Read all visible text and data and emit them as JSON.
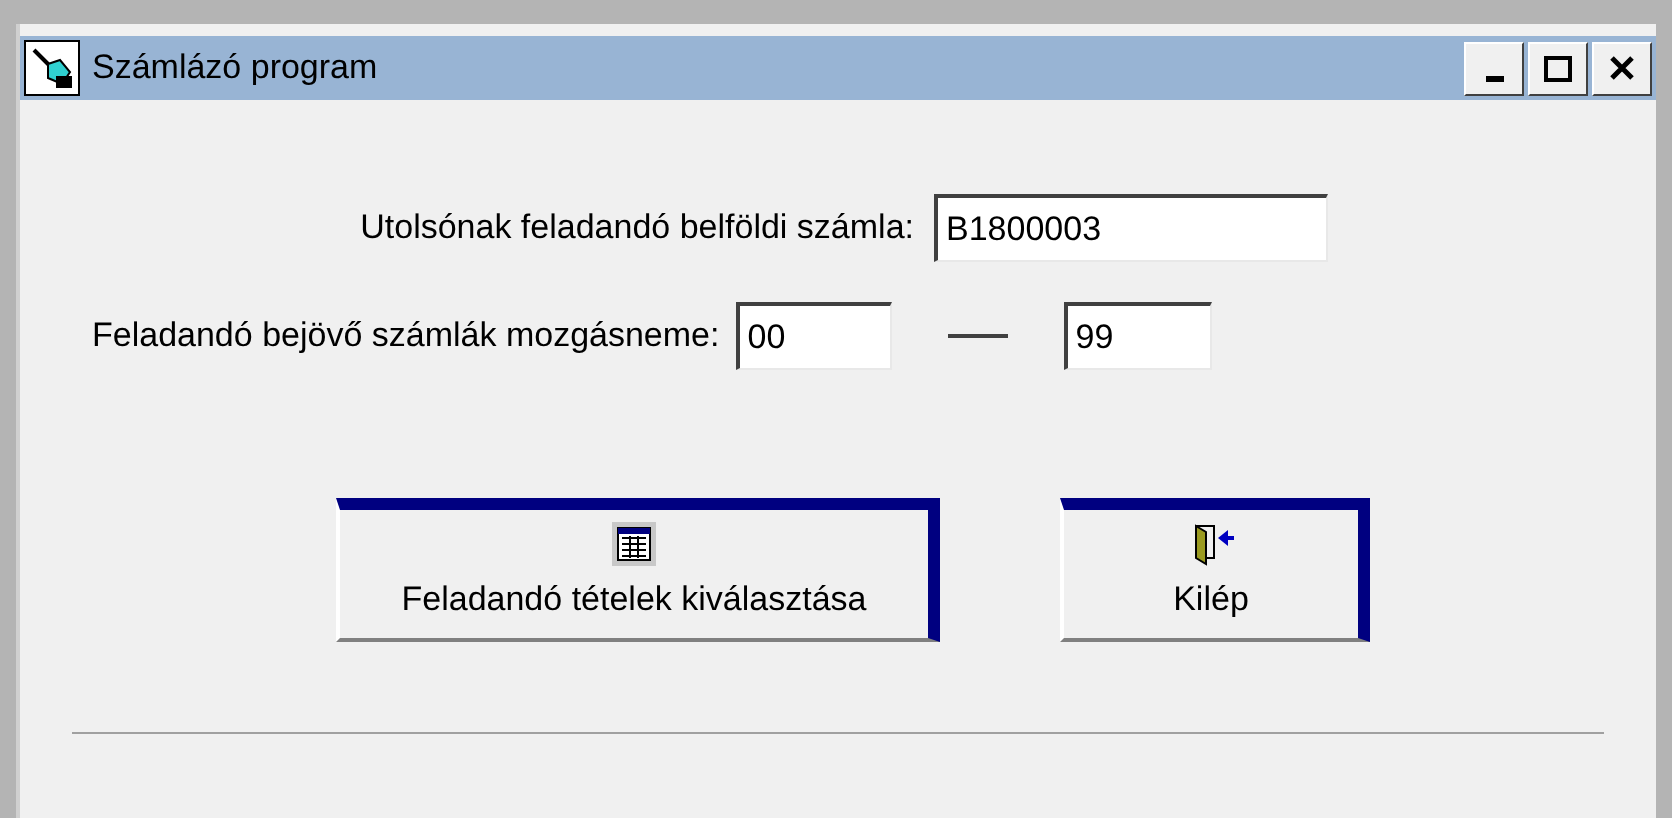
{
  "window": {
    "title": "Számlázó program"
  },
  "fields": [
    {
      "label": "Utolsónak feladandó belföldi számla:",
      "value": "B1800003"
    }
  ],
  "range": {
    "label": "Feladandó bejövő számlák mozgásneme:",
    "from": "00",
    "to": "99"
  },
  "buttons": [
    {
      "kind": "select",
      "label": "Feladandó tételek kiválasztása"
    },
    {
      "kind": "exit",
      "label": "Kilép"
    }
  ]
}
